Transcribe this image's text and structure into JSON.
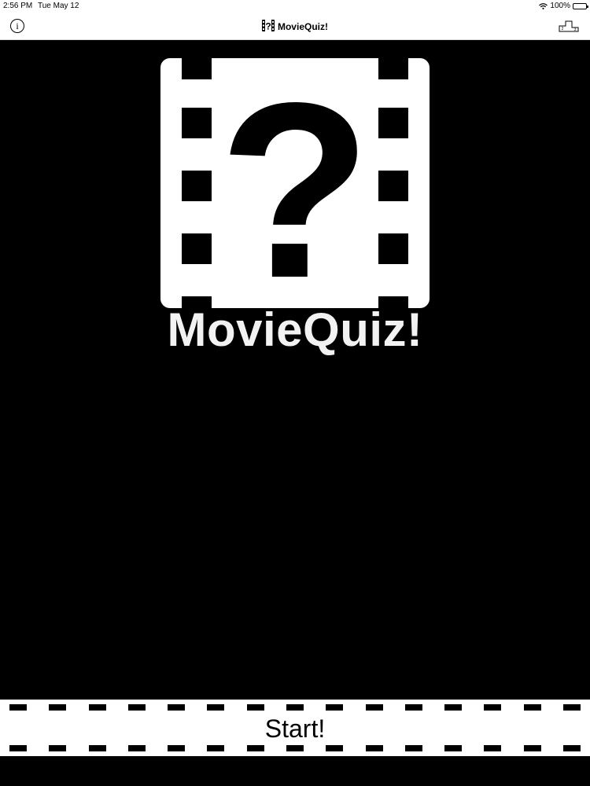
{
  "status_bar": {
    "time": "2:56 PM",
    "date": "Tue May 12",
    "battery": "100%",
    "wifi_icon": "wifi-icon",
    "battery_icon": "battery-icon"
  },
  "nav": {
    "title": "MovieQuiz!",
    "title_icon": "movie-question-icon",
    "info_glyph": "i",
    "info_icon": "info-icon",
    "leaderboard_icon": "podium-icon",
    "leaderboard_ranks": [
      "2",
      "3"
    ]
  },
  "main": {
    "logo_icon": "film-question-logo",
    "app_name": "MovieQuiz!"
  },
  "start_button": {
    "label": "Start!"
  },
  "colors": {
    "background": "#000000",
    "bar": "#ffffff",
    "text_light": "#f2f2f2"
  }
}
